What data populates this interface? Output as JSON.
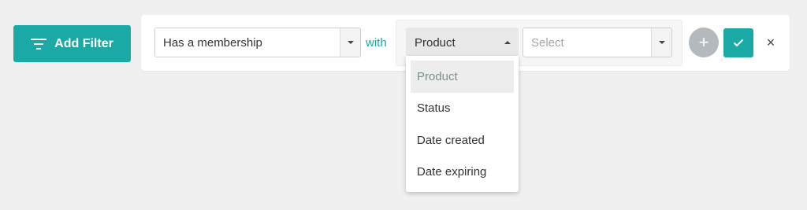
{
  "add_filter": {
    "label": "Add Filter",
    "icon": "filter-icon",
    "color": "#1aa9a5"
  },
  "filter_row": {
    "condition": {
      "value": "Has a membership"
    },
    "connector": "with",
    "field": {
      "value": "Product"
    },
    "value_select": {
      "placeholder": "Select"
    },
    "actions": {
      "add_icon": "+",
      "confirm_icon": "check-icon",
      "close_icon": "×"
    }
  },
  "field_dropdown": {
    "open": true,
    "items": [
      {
        "label": "Product",
        "selected": true
      },
      {
        "label": "Status",
        "selected": false
      },
      {
        "label": "Date created",
        "selected": false
      },
      {
        "label": "Date expiring",
        "selected": false
      }
    ]
  },
  "colors": {
    "accent": "#1aa9a5",
    "background": "#f0f0f0",
    "add_circle": "#b4b9bd"
  }
}
